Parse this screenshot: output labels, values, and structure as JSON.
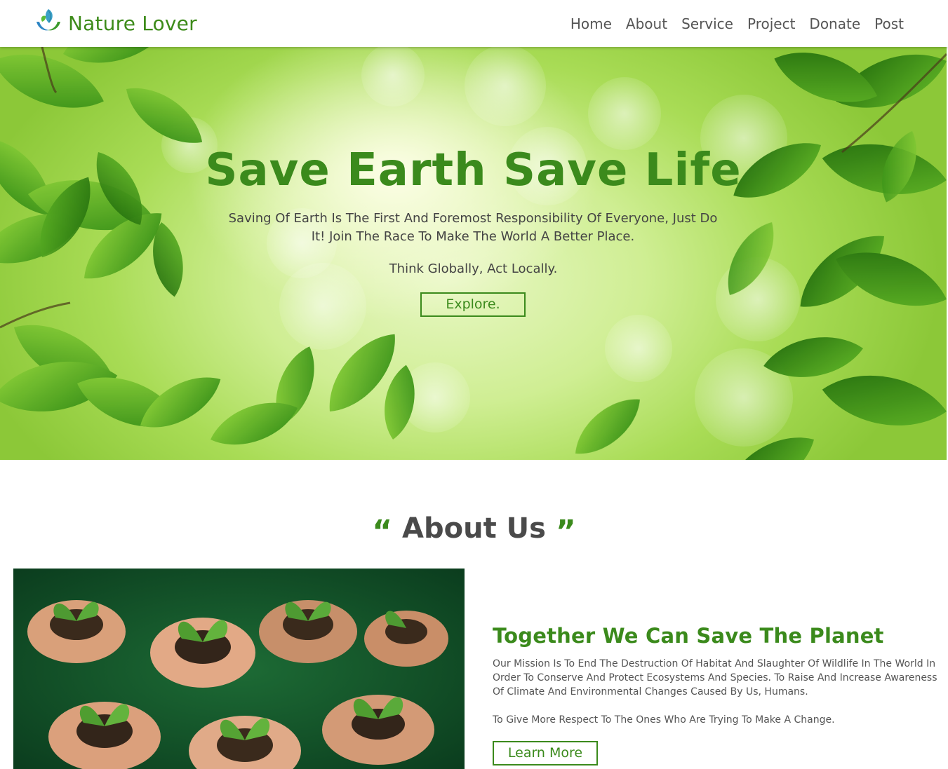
{
  "brand": {
    "name": "Nature Lover",
    "logo_icon": "leaf-hands-icon"
  },
  "nav": {
    "items": [
      {
        "label": "Home"
      },
      {
        "label": "About"
      },
      {
        "label": "Service"
      },
      {
        "label": "Project"
      },
      {
        "label": "Donate"
      },
      {
        "label": "Post"
      }
    ]
  },
  "hero": {
    "title": "Save Earth Save Life",
    "text": "Saving Of Earth Is The First And Foremost Responsibility Of Everyone, Just Do It! Join The Race To Make The World A Better Place.",
    "motto": "Think Globally, Act Locally.",
    "button_label": "Explore."
  },
  "about": {
    "heading": "About Us",
    "open_quote": "“",
    "close_quote": "”",
    "title": "Together We Can Save The Planet",
    "paragraph1": "Our Mission Is To End The Destruction Of Habitat And Slaughter Of Wildlife In The World In Order To Conserve And Protect Ecosystems And Species. To Raise And Increase Awareness Of Climate And Environmental Changes Caused By Us, Humans.",
    "paragraph2": "To Give More Respect To The Ones Who Are Trying To Make A Change.",
    "button_label": "Learn More"
  },
  "colors": {
    "brand_green": "#3b8a1c",
    "text_gray": "#555555",
    "hero_light": "#e8f7c4",
    "hero_dark": "#8cc838"
  }
}
